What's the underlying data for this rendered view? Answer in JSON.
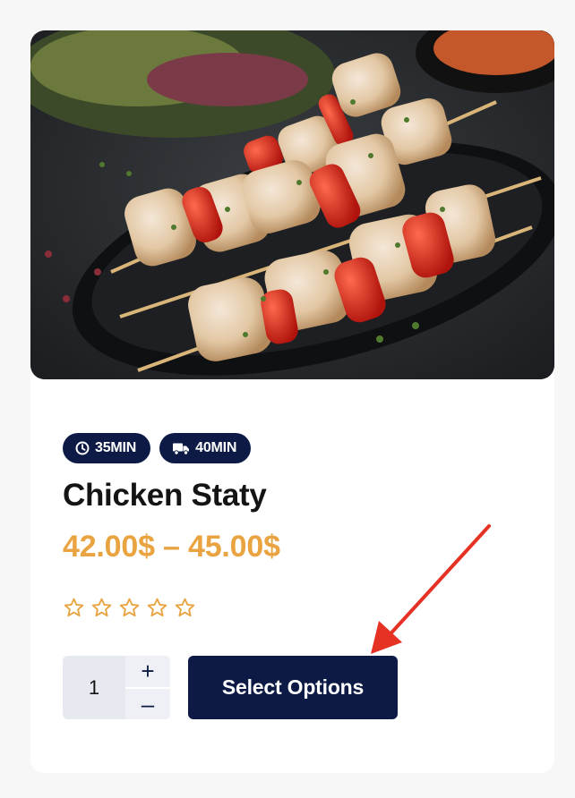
{
  "product": {
    "image_alt": "Chicken skewers with red peppers on a black plate",
    "prep_time": "35MIN",
    "delivery_time": "40MIN",
    "title": "Chicken Staty",
    "price_range": "42.00$ – 45.00$",
    "rating": {
      "value": 0,
      "max": 5
    }
  },
  "cart": {
    "quantity": "1",
    "increment_label": "+",
    "decrement_label": "–",
    "select_label": "Select Options"
  },
  "colors": {
    "navy": "#0c1a45",
    "price": "#e9a340",
    "star": "#e9a340",
    "arrow": "#e53224"
  },
  "icons": {
    "prep": "clock-icon",
    "delivery": "truck-icon",
    "rating": "star-outline-icon"
  }
}
